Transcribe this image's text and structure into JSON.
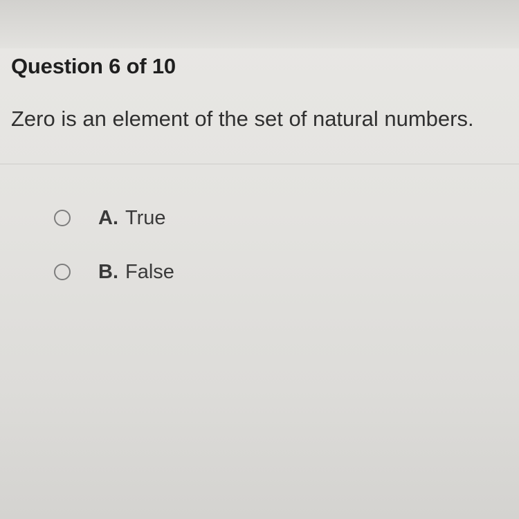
{
  "question": {
    "header": "Question 6 of 10",
    "prompt": "Zero is an element of the set of natural numbers."
  },
  "options": [
    {
      "letter": "A.",
      "text": "True",
      "selected": false
    },
    {
      "letter": "B.",
      "text": "False",
      "selected": false
    }
  ]
}
